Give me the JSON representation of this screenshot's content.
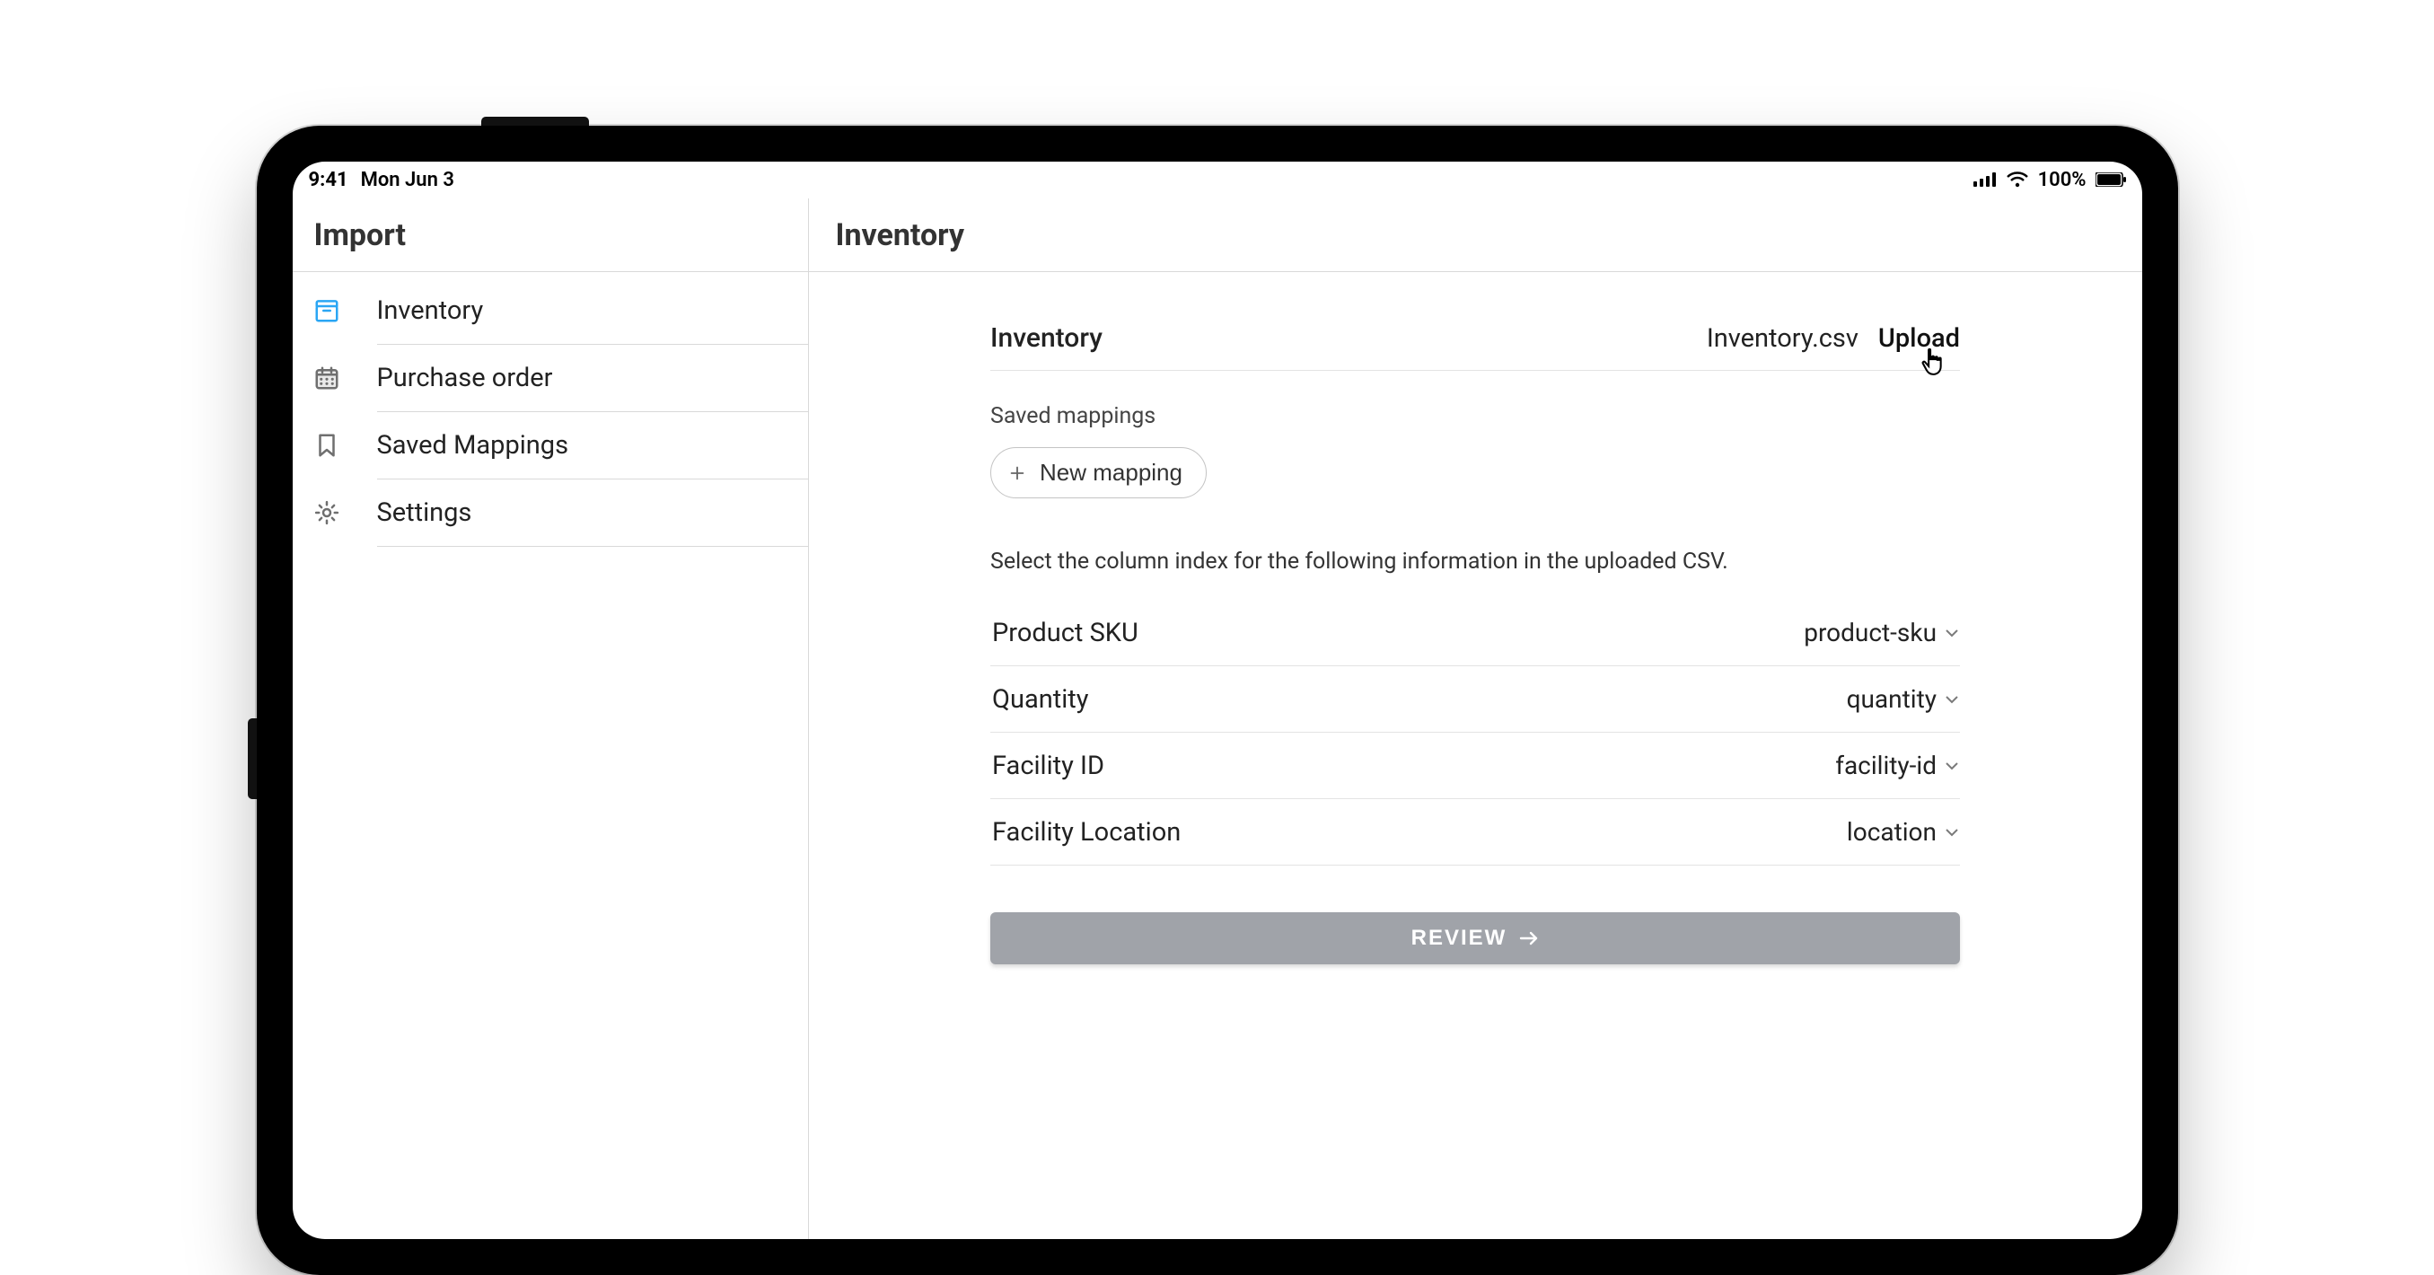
{
  "status_bar": {
    "time": "9:41",
    "date": "Mon Jun 3",
    "battery_percent": "100%"
  },
  "sidebar": {
    "title": "Import",
    "items": [
      {
        "label": "Inventory"
      },
      {
        "label": "Purchase order"
      },
      {
        "label": "Saved Mappings"
      },
      {
        "label": "Settings"
      }
    ]
  },
  "main": {
    "header_title": "Inventory",
    "section_title": "Inventory",
    "file_name": "Inventory.csv",
    "upload_label": "Upload",
    "saved_mappings_label": "Saved mappings",
    "new_mapping_label": "New mapping",
    "instruction": "Select the column index for the following information in the uploaded CSV.",
    "mappings": [
      {
        "label": "Product SKU",
        "value": "product-sku"
      },
      {
        "label": "Quantity",
        "value": "quantity"
      },
      {
        "label": "Facility ID",
        "value": "facility-id"
      },
      {
        "label": "Facility Location",
        "value": "location"
      }
    ],
    "review_label": "REVIEW"
  }
}
